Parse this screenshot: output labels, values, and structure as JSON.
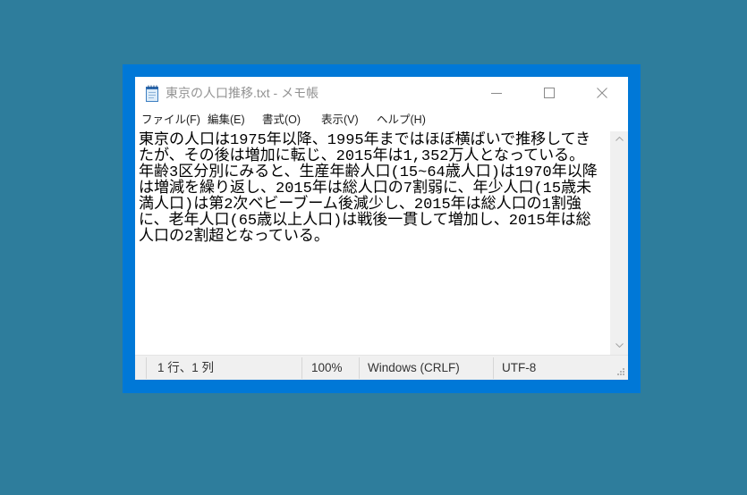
{
  "colors": {
    "desktop_background": "#2e7d9c",
    "window_border": "#0078d7"
  },
  "window": {
    "icon": "notepad-icon",
    "title": "東京の人口推移.txt - メモ帳"
  },
  "title_buttons": {
    "minimize": "minimize-icon",
    "maximize": "maximize-icon",
    "close": "close-icon"
  },
  "menu": [
    {
      "label": "ファイル(F)"
    },
    {
      "label": "編集(E)"
    },
    {
      "label": "書式(O)"
    },
    {
      "label": "表示(V)"
    },
    {
      "label": "ヘルプ(H)"
    }
  ],
  "editor": {
    "lines": [
      "東京の人口は1975年以降、1995年まではほぼ横ばいで推移してき",
      "たが、その後は増加に転じ、2015年は1,352万人となっている。",
      "年齢3区分別にみると、生産年齢人口(15~64歳人口)は1970年以降",
      "は増減を繰り返し、2015年は総人口の7割弱に、年少人口(15歳未",
      "満人口)は第2次ベビーブーム後減少し、2015年は総人口の1割強",
      "に、老年人口(65歳以上人口)は戦後一貫して増加し、2015年は総",
      "人口の2割超となっている。"
    ]
  },
  "scrollbar": {
    "up_icon": "chevron-up-icon",
    "down_icon": "chevron-down-icon"
  },
  "statusbar": {
    "position": "1 行、1 列",
    "zoom": "100%",
    "line_ending": "Windows (CRLF)",
    "encoding": "UTF-8"
  }
}
